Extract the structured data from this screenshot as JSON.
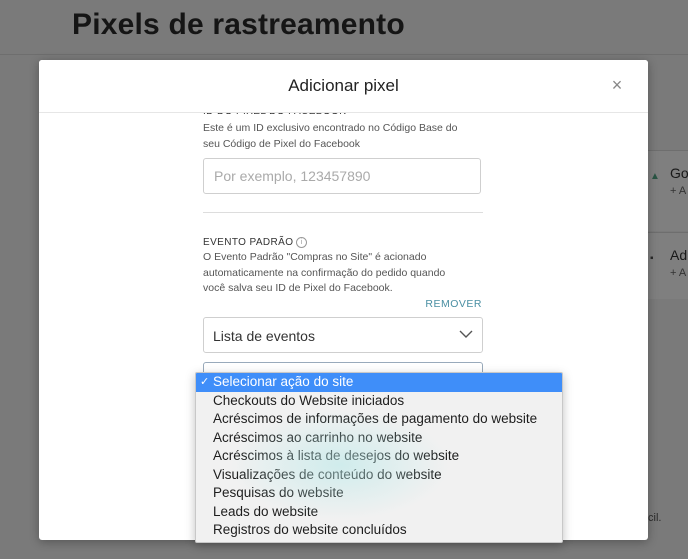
{
  "background": {
    "page_title": "Pixels de rastreamento",
    "card1": {
      "title": "Go",
      "sub": "+ A"
    },
    "card2": {
      "title": "Ad",
      "sub": "+ A"
    },
    "bottom_text": "cil."
  },
  "modal": {
    "title": "Adicionar pixel",
    "close_icon": "×",
    "pixel_id": {
      "label": "ID DO PIXEL DO FACEBOOK",
      "help_line1": "Este é um ID exclusivo encontrado no Código Base do",
      "help_line2": "seu Código de Pixel do Facebook",
      "placeholder": "Por exemplo, 123457890"
    },
    "event": {
      "label": "EVENTO PADRÃO",
      "info_icon": "i",
      "help_line1": "O Evento Padrão \"Compras no Site\" é acionado",
      "help_line2": "automaticamente na confirmação do pedido quando",
      "help_line3": "você salva seu ID de Pixel do Facebook.",
      "remove_label": "REMOVER",
      "select_value": "Lista de eventos"
    }
  },
  "dropdown": {
    "check": "✓",
    "options": [
      "Selecionar ação do site",
      "Checkouts do Website iniciados",
      "Acréscimos de informações de pagamento do website",
      "Acréscimos ao carrinho no website",
      "Acréscimos à lista de desejos do website",
      "Visualizações de conteúdo do website",
      "Pesquisas do website",
      "Leads do website",
      "Registros do website concluídos"
    ],
    "selected_index": 0,
    "selected_color": "#3f8ef9"
  }
}
